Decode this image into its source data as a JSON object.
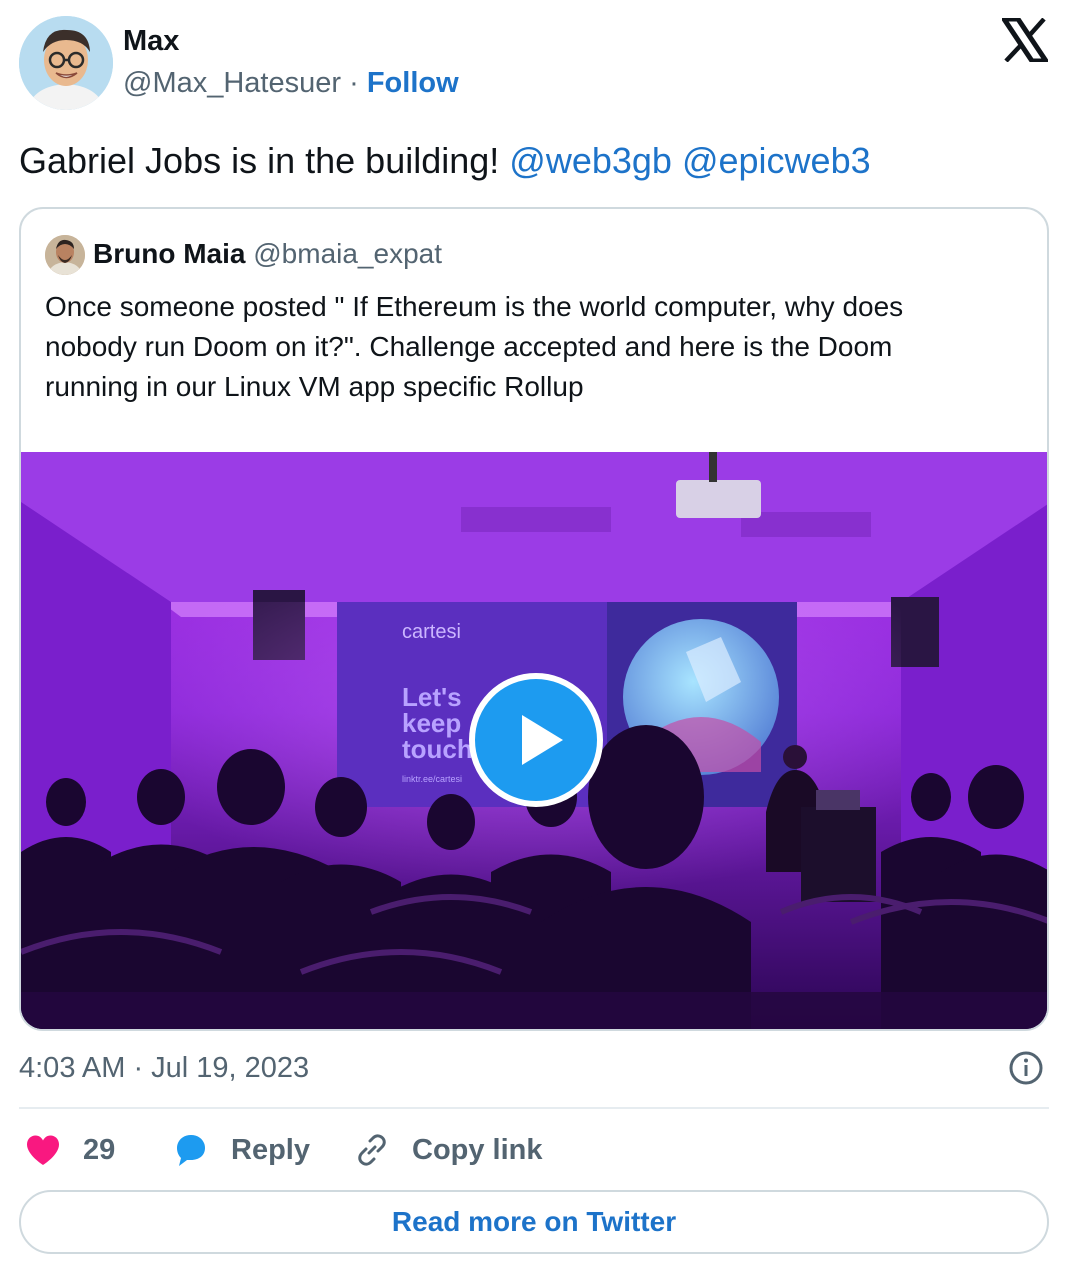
{
  "author": {
    "name": "Max",
    "handle": "@Max_Hatesuer",
    "separator": "·",
    "follow_label": "Follow"
  },
  "tweet": {
    "text": "Gabriel Jobs is in the building!",
    "mentions": [
      "@web3gb",
      "@epicweb3"
    ]
  },
  "quoted_tweet": {
    "author_name": "Bruno Maia",
    "author_handle": "@bmaia_expat",
    "text": "Once someone posted \" If Ethereum is the world computer, why does\nnobody run Doom on it?\". Challenge accepted and here is the Doom\nrunning in our  Linux VM app specific Rollup",
    "media": {
      "slide_brand": "cartesi",
      "slide_headline": [
        "Let's",
        "keep",
        "touch"
      ],
      "slide_link": "linktr.ee/cartesi"
    }
  },
  "timestamp": "4:03 AM · Jul 19, 2023",
  "actions": {
    "like_count": "29",
    "reply_label": "Reply",
    "copy_link_label": "Copy link"
  },
  "read_more_label": "Read more on Twitter",
  "colors": {
    "link": "#1d73c9",
    "like": "#f91880",
    "reply": "#1d9bf0",
    "muted": "#536471",
    "border": "#cfd9de"
  },
  "icons": [
    "x-logo-icon",
    "play-icon",
    "info-icon",
    "heart-icon",
    "reply-bubble-icon",
    "link-icon"
  ]
}
